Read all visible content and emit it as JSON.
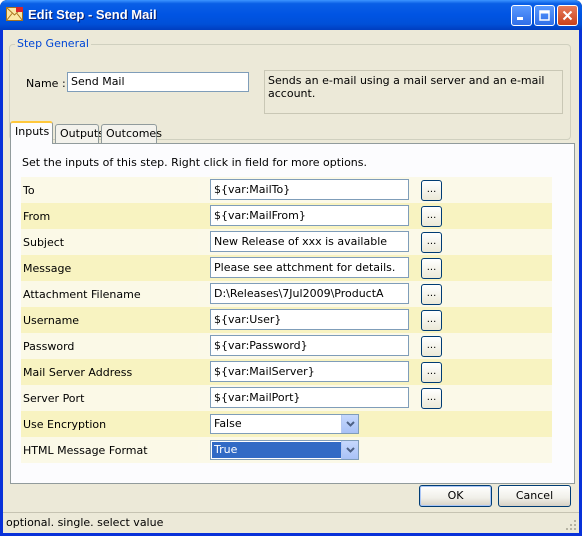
{
  "window": {
    "title": "Edit Step - Send Mail",
    "title_color": "#0054e3"
  },
  "step_general": {
    "legend": "Step General",
    "name_label": "Name :",
    "name_value": "Send Mail",
    "description": "Sends an e-mail using a mail server and an e-mail account."
  },
  "tabs": [
    {
      "label": "Inputs",
      "active": true
    },
    {
      "label": "Outputs",
      "active": false
    },
    {
      "label": "Outcomes",
      "active": false
    }
  ],
  "inputs": {
    "instructions": "Set the inputs of this step.  Right click in field for more options.",
    "rows": [
      {
        "label": "To",
        "value": "${var:MailTo}",
        "type": "text"
      },
      {
        "label": "From",
        "value": "${var:MailFrom}",
        "type": "text"
      },
      {
        "label": "Subject",
        "value": "New Release of xxx is available",
        "type": "text"
      },
      {
        "label": "Message",
        "value": "Please see attchment for details.",
        "type": "text"
      },
      {
        "label": "Attachment Filename",
        "value": "D:\\Releases\\7Jul2009\\ProductA",
        "type": "text"
      },
      {
        "label": "Username",
        "value": "${var:User}",
        "type": "text"
      },
      {
        "label": "Password",
        "value": "${var:Password}",
        "type": "text"
      },
      {
        "label": "Mail Server Address",
        "value": "${var:MailServer}",
        "type": "text"
      },
      {
        "label": "Server Port",
        "value": "${var:MailPort}",
        "type": "text"
      },
      {
        "label": "Use Encryption",
        "value": "False",
        "type": "select"
      },
      {
        "label": "HTML Message Format",
        "value": "True",
        "type": "select"
      }
    ],
    "ellipsis_label": "...",
    "row_colors": {
      "odd": "#fbf9e7",
      "even": "#f8f3c1"
    }
  },
  "buttons": {
    "ok": "OK",
    "cancel": "Cancel"
  },
  "status": {
    "text": "optional. single. select value"
  }
}
